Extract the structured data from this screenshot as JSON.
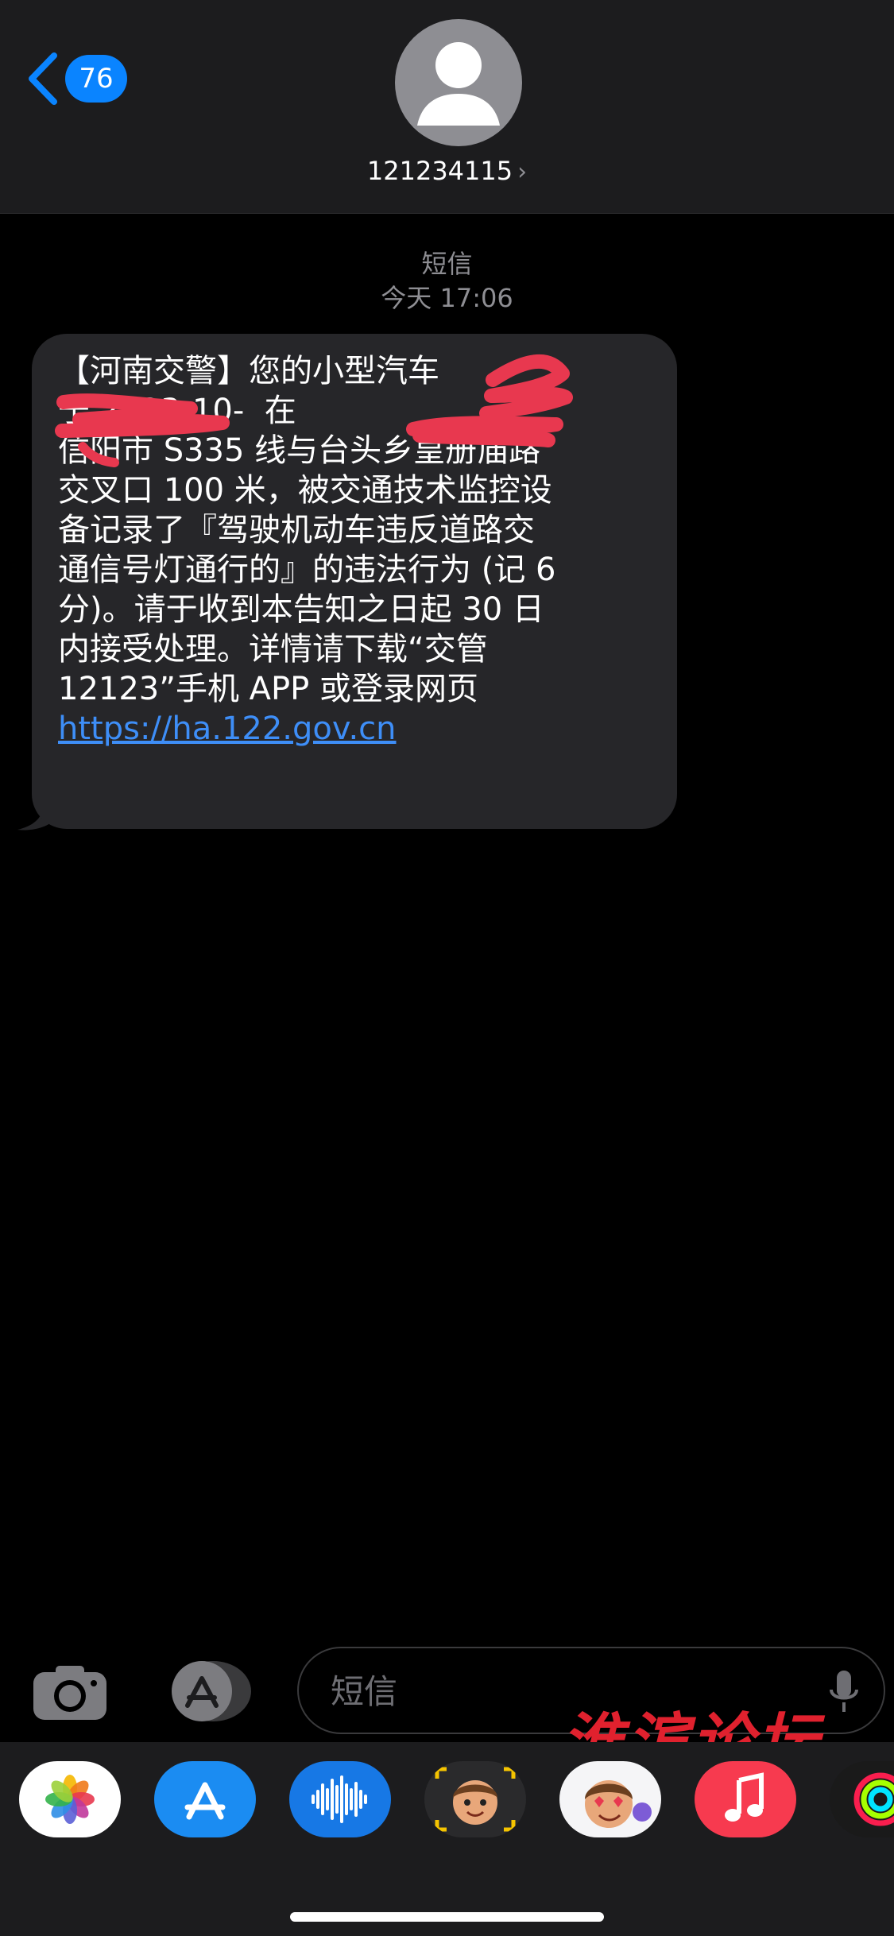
{
  "header": {
    "back_count": "76",
    "contact_name": "121234115",
    "contact_chevron": "›"
  },
  "thread": {
    "service_label": "短信",
    "timestamp": "今天 17:06"
  },
  "message": {
    "text": "【河南交警】您的小型汽车\n于 2023-10-  在\n信阳市 S335 线与台头乡皇册庙路\n交叉口 100 米，被交通技术监控设\n备记录了『驾驶机动车违反道路交\n通信号灯通行的』的违法行为 (记 6\n分)。请于收到本告知之日起 30 日\n内接受处理。详情请下载“交管\n12123”手机 APP 或登录网页",
    "link": "https://ha.122.gov.cn"
  },
  "input": {
    "placeholder": "短信"
  },
  "watermark": "淮滨论坛",
  "icons": {
    "back": "chevron-left-icon",
    "avatar": "person-icon",
    "camera": "camera-icon",
    "store": "app-store-icon",
    "mic": "microphone-icon"
  },
  "apps": [
    "photos-app-icon",
    "app-store-app-icon",
    "audio-message-app-icon",
    "memoji-camera-app-icon",
    "memoji-stickers-app-icon",
    "music-app-icon",
    "activity-app-icon"
  ],
  "colors": {
    "accent": "#0a84ff",
    "bubble": "#262629",
    "link": "#3e8ef7",
    "redaction": "#e8384f",
    "watermark": "#e0212e"
  }
}
